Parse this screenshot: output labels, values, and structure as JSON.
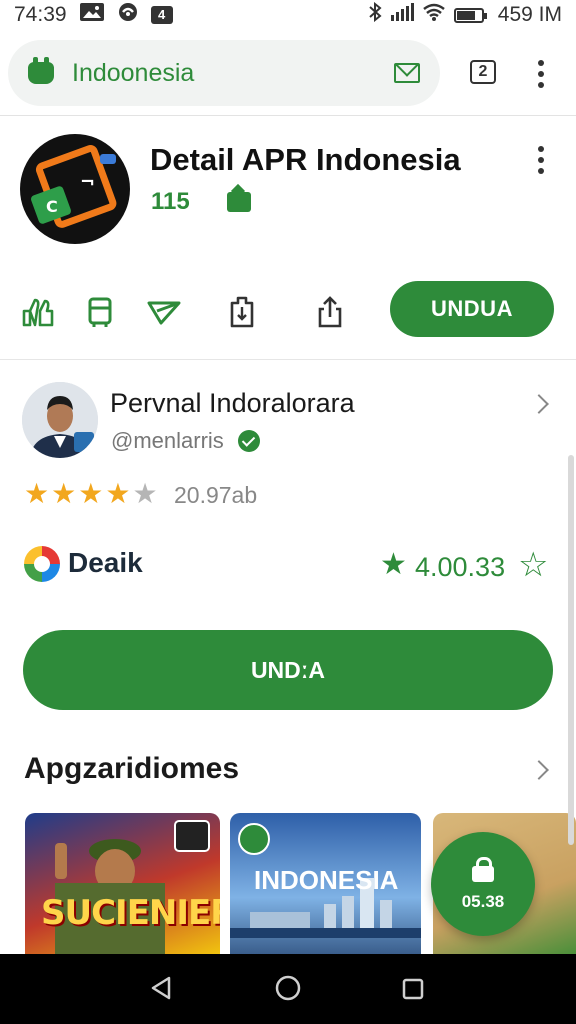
{
  "status_bar": {
    "time": "74:39",
    "notif_box": "4",
    "right_time": "459 IM"
  },
  "url_bar": {
    "url": "Indoonesia",
    "tabs_count": "2"
  },
  "app": {
    "title": "Detail APR Indonesia",
    "count": "115",
    "install_label": "UNDUA"
  },
  "publisher": {
    "name": "Pervnal Indoralorara",
    "handle": "@menlarris",
    "rating_stars": 4,
    "rating_count": "20.97ab"
  },
  "brand": {
    "name": "Deaik",
    "score": "4.00.33"
  },
  "big_button": {
    "label": "UNDːA"
  },
  "section": {
    "title": "Apgzaridiomes",
    "cards": [
      {
        "text": "SUCIENIER"
      },
      {
        "text": "INDONESIA"
      },
      {
        "text": ""
      }
    ],
    "fab_label": "05.38"
  },
  "icons": {
    "action_row": [
      "thumbs-icon",
      "bookmark-icon",
      "send-icon",
      "download-icon",
      "share-icon"
    ],
    "nav": [
      "back-icon",
      "home-icon",
      "recents-icon"
    ]
  },
  "colors": {
    "accent": "#2e8b3a",
    "star": "#f2a71e"
  }
}
